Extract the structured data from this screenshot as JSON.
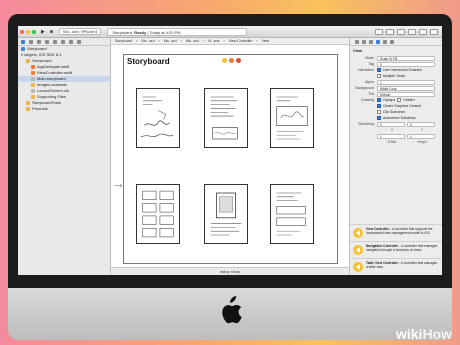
{
  "toolbar": {
    "scheme_app": "Sto...ard",
    "scheme_device": "iPhone 6",
    "status_app": "Storyboard",
    "status_state": "Ready",
    "status_time": "Today at 4:20 PM"
  },
  "navigator": {
    "items": [
      {
        "label": "Storyboard",
        "icon": "project-icon",
        "indent": 0
      },
      {
        "label": "2 targets, iOS SDK 8.1",
        "icon": "",
        "indent": 0
      },
      {
        "label": "Storyboard",
        "icon": "folder-icon",
        "indent": 1
      },
      {
        "label": "AppDelegate.swift",
        "icon": "swift-icon",
        "indent": 2
      },
      {
        "label": "ViewController.swift",
        "icon": "swift-icon",
        "indent": 2
      },
      {
        "label": "Main.storyboard",
        "icon": "storyboard-icon",
        "indent": 2,
        "selected": true
      },
      {
        "label": "Images.xcassets",
        "icon": "folder-icon",
        "indent": 2
      },
      {
        "label": "LaunchScreen.xib",
        "icon": "storyboard-icon",
        "indent": 2
      },
      {
        "label": "Supporting Files",
        "icon": "folder-icon",
        "indent": 2
      },
      {
        "label": "StoryboardTests",
        "icon": "folder-icon",
        "indent": 1
      },
      {
        "label": "Products",
        "icon": "folder-icon",
        "indent": 1
      }
    ]
  },
  "editor": {
    "jump_bar": [
      "Storyboard",
      "Sto...ard",
      "Ma...ard",
      "Ma...ard",
      "Vi...ene",
      "View Controller",
      "View"
    ],
    "canvas_title": "Storyboard",
    "size_class": "wAny hAny"
  },
  "inspector": {
    "header": "View",
    "props": [
      {
        "label": "Mode",
        "value": "Scale To Fill"
      },
      {
        "label": "Tag",
        "value": "0"
      }
    ],
    "interaction": [
      "User Interaction Enabled",
      "Multiple Touch"
    ],
    "alpha_label": "Alpha",
    "alpha_value": "1",
    "background_label": "Background",
    "background_value": "White Color",
    "tint_label": "Tint",
    "tint_value": "Default",
    "drawing_label": "Drawing",
    "drawing": [
      "Opaque",
      "Hidden",
      "Clears Graphics Context",
      "Clip Subviews",
      "Autoresize Subviews"
    ],
    "stretching_label": "Stretching",
    "stretch_x": "0",
    "stretch_y": "0",
    "stretch_w": "1",
    "stretch_h": "1",
    "stretch_caps": [
      "X",
      "Y",
      "Width",
      "Height"
    ]
  },
  "library": [
    {
      "title": "View Controller",
      "desc": "- A controller that supports the fundamental view-management model in iOS."
    },
    {
      "title": "Navigation Controller",
      "desc": "- A controller that manages navigation through a hierarchy of views."
    },
    {
      "title": "Table View Controller",
      "desc": "- A controller that manages a table view."
    }
  ],
  "watermark": {
    "a": "wiki",
    "b": "How"
  },
  "colors": {
    "accent": "#3a7ddb",
    "library_icon": "#f3c23a"
  }
}
